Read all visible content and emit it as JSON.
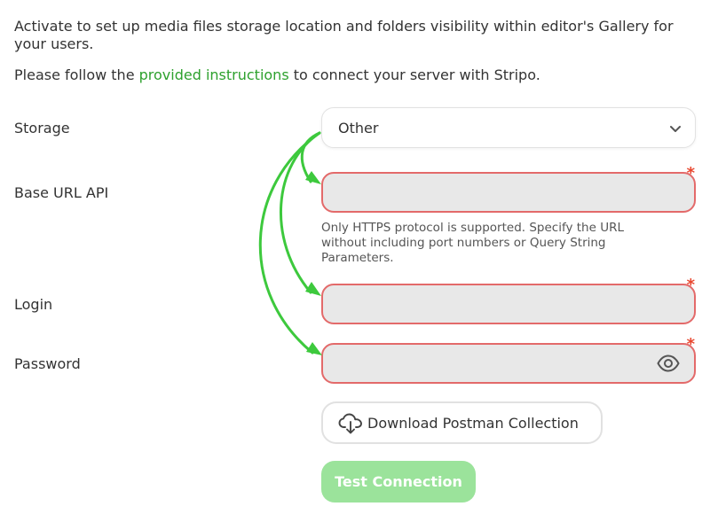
{
  "intro": {
    "text": "Activate to set up media files storage location and folders visibility within editor's Gallery for your users.",
    "instructions_prefix": "Please follow the ",
    "instructions_link": "provided instructions",
    "instructions_suffix": " to connect your server with Stripo."
  },
  "form": {
    "storage": {
      "label": "Storage",
      "selected": "Other",
      "icon": "chevron-down-icon"
    },
    "base_url": {
      "label": "Base URL API",
      "value": "",
      "required_mark": "*",
      "hint": "Only HTTPS protocol is supported. Specify the URL without including port numbers or Query String Parameters."
    },
    "login": {
      "label": "Login",
      "value": "",
      "required_mark": "*"
    },
    "password": {
      "label": "Password",
      "value": "",
      "required_mark": "*",
      "icon": "eye-icon"
    }
  },
  "buttons": {
    "postman": {
      "label": "Download Postman Collection",
      "icon": "cloud-download-icon"
    },
    "test": {
      "label": "Test Connection"
    }
  },
  "colors": {
    "link": "#2ea12e",
    "field_error_border": "#e36a6a",
    "required_star": "#e8462e",
    "field_fill": "#e8e8e8",
    "test_button": "#9be39b",
    "annotation_arrows": "#3dc93d"
  }
}
